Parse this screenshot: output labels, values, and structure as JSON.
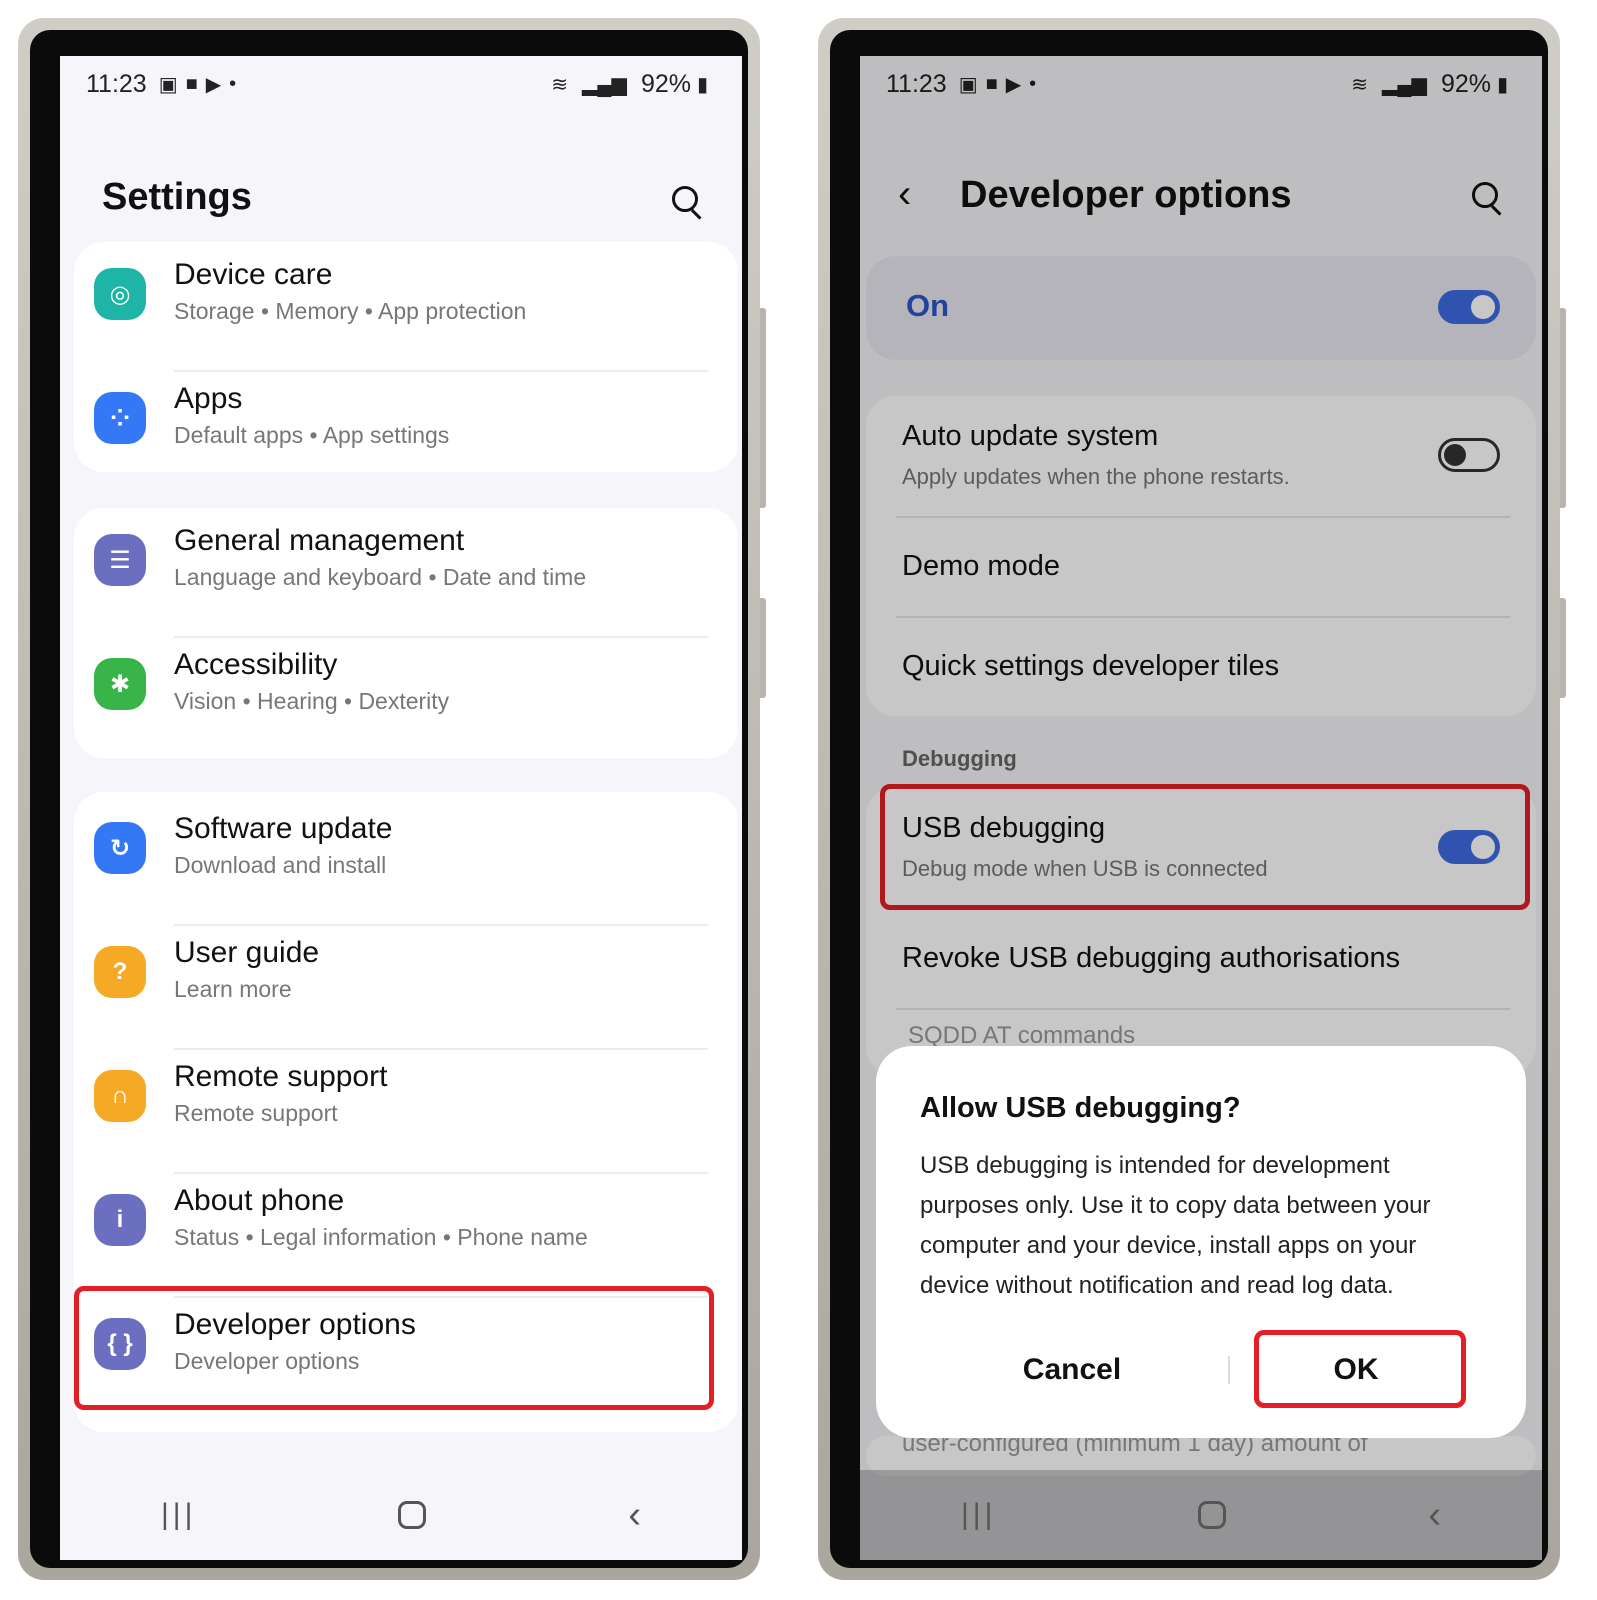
{
  "status_left": {
    "time": "11:23",
    "battery": "92%"
  },
  "status_right": {
    "time": "11:23",
    "battery": "92%"
  },
  "settings": {
    "title": "Settings",
    "groups": [
      [
        {
          "title": "Device care",
          "sub": "Storage  •  Memory  •  App protection",
          "icon": "device-care-icon",
          "color": "#1eb5a6"
        },
        {
          "title": "Apps",
          "sub": "Default apps  •  App settings",
          "icon": "apps-icon",
          "color": "#3478f6"
        }
      ],
      [
        {
          "title": "General management",
          "sub": "Language and keyboard  •  Date and time",
          "icon": "sliders-icon",
          "color": "#6c6fc0"
        },
        {
          "title": "Accessibility",
          "sub": "Vision  •  Hearing  •  Dexterity",
          "icon": "accessibility-icon",
          "color": "#38b449"
        }
      ],
      [
        {
          "title": "Software update",
          "sub": "Download and install",
          "icon": "software-update-icon",
          "color": "#3478f6"
        },
        {
          "title": "User guide",
          "sub": "Learn more",
          "icon": "user-guide-icon",
          "color": "#f6a924"
        },
        {
          "title": "Remote support",
          "sub": "Remote support",
          "icon": "headset-icon",
          "color": "#f6a924"
        },
        {
          "title": "About phone",
          "sub": "Status  •  Legal information  •  Phone name",
          "icon": "info-icon",
          "color": "#6c6fc0"
        },
        {
          "title": "Developer options",
          "sub": "Developer options",
          "icon": "braces-icon",
          "color": "#6c6fc0"
        }
      ]
    ]
  },
  "developer": {
    "title": "Developer options",
    "on_label": "On",
    "auto_update": {
      "title": "Auto update system",
      "sub": "Apply updates when the phone restarts."
    },
    "demo_mode": "Demo mode",
    "quick_tiles": "Quick settings developer tiles",
    "section_debugging": "Debugging",
    "usb_debugging": {
      "title": "USB debugging",
      "sub": "Debug mode when USB is connected"
    },
    "revoke": "Revoke USB debugging authorisations",
    "peek_top": "SQDD AT commands",
    "peek_bottom": "user-configured (minimum 1 day) amount of"
  },
  "dialog": {
    "title": "Allow USB debugging?",
    "body": "USB debugging is intended for development purposes only. Use it to copy data between your computer and your device, install apps on your device without notification and read log data.",
    "cancel": "Cancel",
    "ok": "OK"
  },
  "colors": {
    "highlight": "#e31e24",
    "toggle_on": "#3e6be0",
    "on_text": "#2e55c7"
  }
}
